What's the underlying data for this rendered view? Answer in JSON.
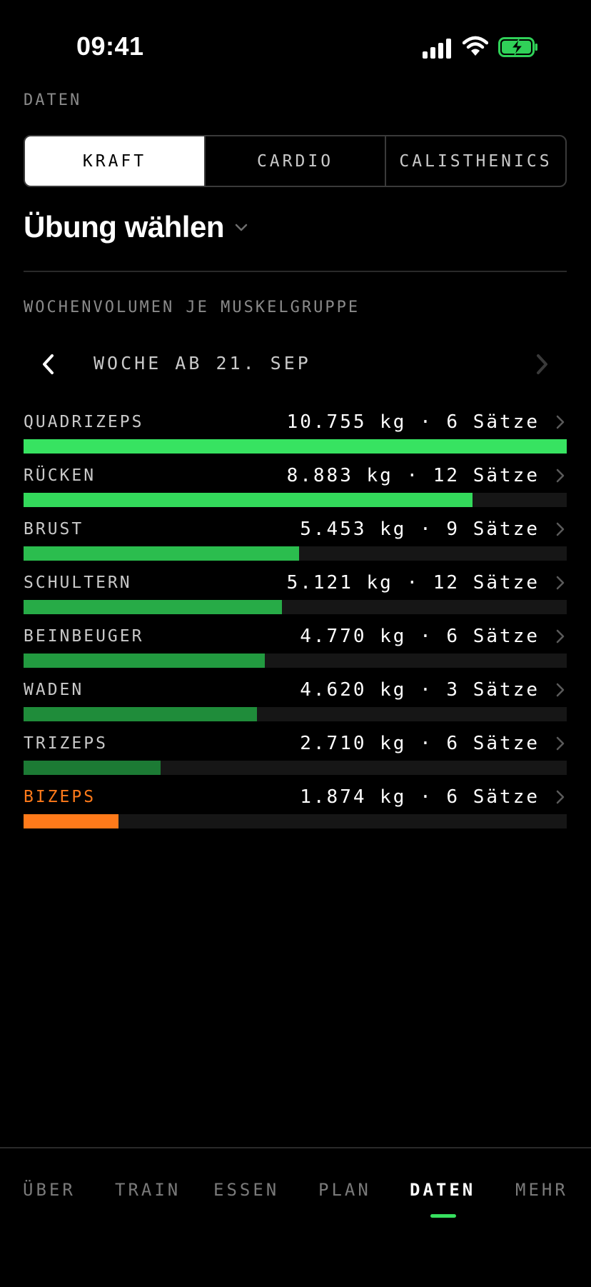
{
  "status": {
    "time": "09:41",
    "battery_color": "#30d158"
  },
  "header": {
    "section": "DATEN"
  },
  "segments": [
    {
      "label": "KRAFT",
      "active": true
    },
    {
      "label": "CARDIO",
      "active": false
    },
    {
      "label": "CALISTHENICS",
      "active": false
    }
  ],
  "exercise_picker": {
    "label": "Übung wählen"
  },
  "chart": {
    "title": "WOCHENVOLUMEN JE MUSKELGRUPPE",
    "week_label": "WOCHE AB 21. SEP"
  },
  "chart_data": {
    "type": "bar",
    "title": "WOCHENVOLUMEN JE MUSKELGRUPPE",
    "categories": [
      "QUADRIZEPS",
      "RÜCKEN",
      "BRUST",
      "SCHULTERN",
      "BEINBEUGER",
      "WADEN",
      "TRIZEPS",
      "BIZEPS"
    ],
    "values": [
      10755,
      8883,
      5453,
      5121,
      4770,
      4620,
      2710,
      1874
    ],
    "sets": [
      6,
      12,
      9,
      12,
      6,
      3,
      6,
      6
    ],
    "value_labels": [
      "10.755 kg · 6 Sätze",
      "8.883 kg · 12 Sätze",
      "5.453 kg · 9 Sätze",
      "5.121 kg · 12 Sätze",
      "4.770 kg · 6 Sätze",
      "4.620 kg · 3 Sätze",
      "2.710 kg · 6 Sätze",
      "1.874 kg · 6 Sätze"
    ],
    "colors": [
      "#37e361",
      "#33d95b",
      "#2bbd4e",
      "#27ab47",
      "#229a40",
      "#1f8c3a",
      "#1c7a34",
      "#ff7a1a"
    ],
    "highlight_label_color": "#ff7a1a",
    "xlim": [
      0,
      10755
    ]
  },
  "tabbar": {
    "tabs": [
      {
        "label": "ÜBER",
        "active": false
      },
      {
        "label": "TRAIN",
        "active": false
      },
      {
        "label": "ESSEN",
        "active": false
      },
      {
        "label": "PLAN",
        "active": false
      },
      {
        "label": "DATEN",
        "active": true
      },
      {
        "label": "MEHR",
        "active": false
      }
    ],
    "accent": "#37e05f"
  }
}
